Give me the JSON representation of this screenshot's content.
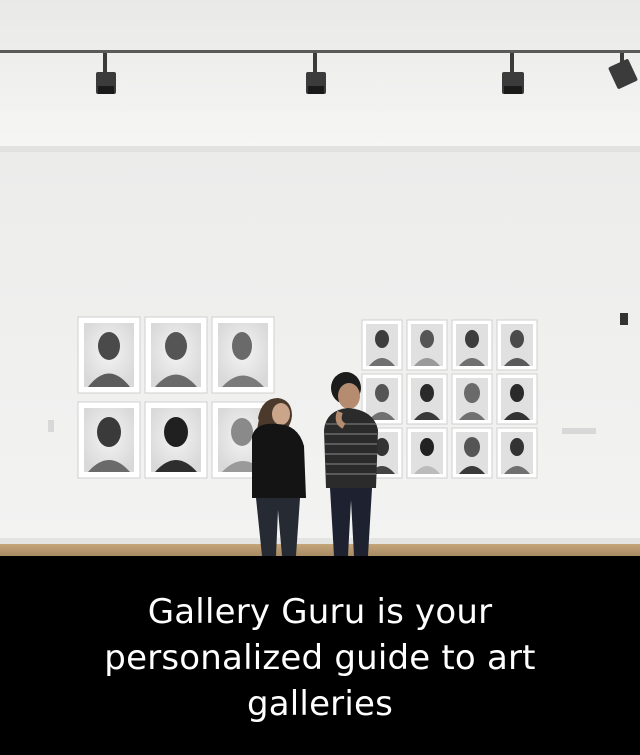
{
  "hero": {
    "scene": "gallery-interior-photo",
    "colors": {
      "wall": "#efefee",
      "ceiling": "#f2f2f2",
      "floor": "#b79a72",
      "caption_background": "#000000",
      "caption_text": "#ffffff"
    }
  },
  "caption": {
    "text": "Gallery Guru is your personalized guide to art galleries"
  }
}
